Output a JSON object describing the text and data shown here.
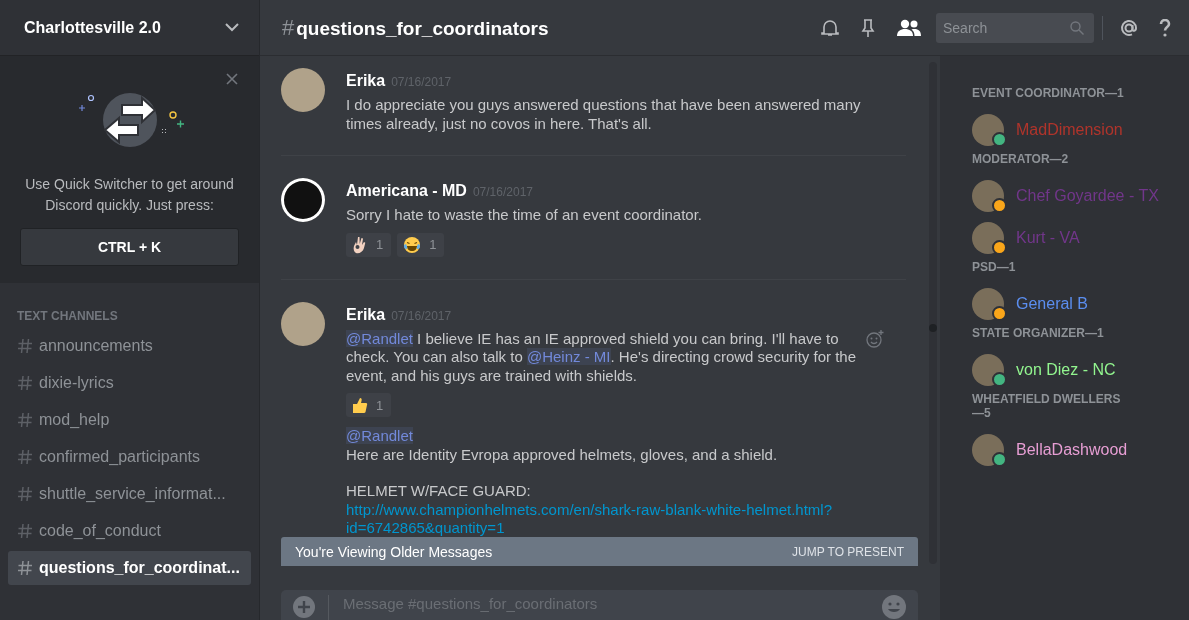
{
  "server": {
    "name": "Charlottesville 2.0"
  },
  "quick_switcher": {
    "text": "Use Quick Switcher to get around Discord quickly. Just press:",
    "shortcut": "CTRL + K"
  },
  "channel_category": "TEXT CHANNELS",
  "channels": [
    {
      "name": "announcements",
      "selected": false
    },
    {
      "name": "dixie-lyrics",
      "selected": false
    },
    {
      "name": "mod_help",
      "selected": false
    },
    {
      "name": "confirmed_participants",
      "selected": false
    },
    {
      "name": "shuttle_service_informat...",
      "selected": false
    },
    {
      "name": "code_of_conduct",
      "selected": false
    },
    {
      "name": "questions_for_coordinat...",
      "selected": true
    }
  ],
  "header": {
    "hash": "#",
    "channel": "questions_for_coordinators",
    "search_placeholder": "Search",
    "members_on": true
  },
  "messages": [
    {
      "author": "Erika",
      "timestamp": "07/16/2017",
      "avatar": {
        "kind": "photo"
      },
      "hovered": false,
      "blocks": [
        {
          "kind": "text",
          "lines": [
            [
              {
                "kind": "plain",
                "text": "I do appreciate you guys answered questions that have been answered many times already, just no covos in here. That's all."
              }
            ]
          ]
        }
      ]
    },
    {
      "author": "Americana - MD",
      "timestamp": "07/16/2017",
      "avatar": {
        "kind": "logo"
      },
      "hovered": false,
      "blocks": [
        {
          "kind": "text",
          "lines": [
            [
              {
                "kind": "plain",
                "text": "Sorry I hate to waste the time of an event coordinator."
              }
            ]
          ]
        },
        {
          "kind": "reactions",
          "items": [
            {
              "kind": "ok_hand",
              "count": "1"
            },
            {
              "kind": "tears_of_joy",
              "count": "1"
            }
          ]
        }
      ]
    },
    {
      "author": "Erika",
      "timestamp": "07/16/2017",
      "avatar": {
        "kind": "photo"
      },
      "hovered": true,
      "blocks": [
        {
          "kind": "text",
          "lines": [
            [
              {
                "kind": "mention",
                "text": "@Randlet"
              },
              {
                "kind": "plain",
                "text": " I believe IE has an IE approved shield you can bring. I'll have to check. You can also talk to "
              },
              {
                "kind": "mention",
                "text": "@Heinz - MI"
              },
              {
                "kind": "plain",
                "text": ". He's directing crowd security for the event, and his guys are trained with shields."
              }
            ]
          ]
        },
        {
          "kind": "reactions",
          "items": [
            {
              "kind": "thumbs_up",
              "count": "1"
            }
          ]
        },
        {
          "kind": "text",
          "lines": [
            [
              {
                "kind": "mention",
                "text": "@Randlet"
              }
            ],
            [
              {
                "kind": "plain",
                "text": "Here are Identity Evropa approved helmets, gloves, and a shield."
              }
            ]
          ]
        },
        {
          "kind": "text",
          "lines": [
            [
              {
                "kind": "plain",
                "text": "HELMET W/FACE GUARD:"
              }
            ],
            [
              {
                "kind": "link",
                "text": "http://www.championhelmets.com/en/shark-raw-blank-white-helmet.html?id=6742865&quantity=1"
              }
            ]
          ]
        }
      ]
    }
  ],
  "older_banner": {
    "text": "You're Viewing Older Messages",
    "action": "JUMP TO PRESENT"
  },
  "composer": {
    "placeholder": "Message #questions_for_coordinators"
  },
  "member_groups": [
    {
      "title": "EVENT COORDINATOR—1",
      "members": [
        {
          "name": "MadDimension",
          "color": "#b0342b",
          "online": true
        }
      ]
    },
    {
      "title": "MODERATOR—2",
      "members": [
        {
          "name": "Chef Goyardee - TX",
          "color": "#71368a",
          "online": false
        },
        {
          "name": "Kurt - VA",
          "color": "#71368a",
          "online": false
        }
      ]
    },
    {
      "title": "PSD—1",
      "members": [
        {
          "name": "General B",
          "color": "#5b8ef0",
          "online": false
        }
      ]
    },
    {
      "title": "STATE ORGANIZER—1",
      "members": [
        {
          "name": "von Diez - NC",
          "color": "#92f58f",
          "online": true
        }
      ]
    },
    {
      "title": "WHEATFIELD DWELLERS—5",
      "members": [
        {
          "name": "BellaDashwood",
          "color": "#e79ed4",
          "online": true
        }
      ]
    }
  ]
}
